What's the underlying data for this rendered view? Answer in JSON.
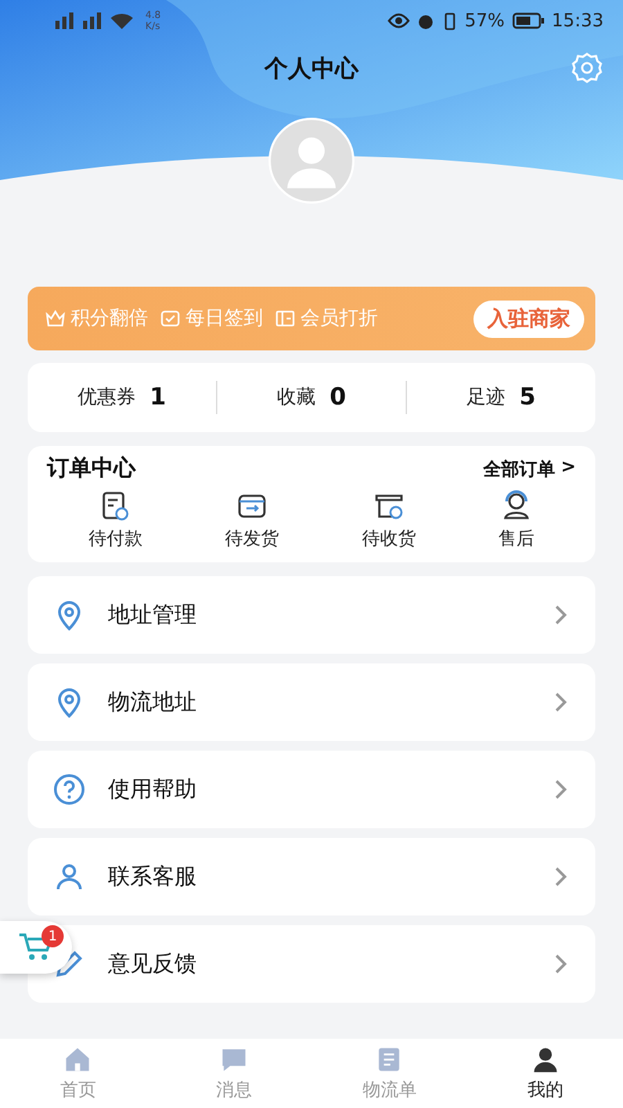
{
  "status_bar": {
    "speed_value": "4.8",
    "speed_unit": "K/s",
    "battery": "57%",
    "time": "15:33"
  },
  "header": {
    "title": "个人中心"
  },
  "promo_banner": {
    "perks": [
      {
        "kind": "crown",
        "label": "积分翻倍"
      },
      {
        "kind": "calendar",
        "label": "每日签到"
      },
      {
        "kind": "ticket",
        "label": "会员打折"
      }
    ],
    "button": "入驻商家"
  },
  "stats": [
    {
      "label": "优惠券",
      "value": "1"
    },
    {
      "label": "收藏",
      "value": "0"
    },
    {
      "label": "足迹",
      "value": "5"
    }
  ],
  "orders": {
    "title": "订单中心",
    "all_link": "全部订单",
    "all_link_arrow": ">",
    "items": [
      {
        "kind": "payment",
        "label": "待付款"
      },
      {
        "kind": "shipment",
        "label": "待发货"
      },
      {
        "kind": "receipt",
        "label": "待收货"
      },
      {
        "kind": "service",
        "label": "售后"
      }
    ]
  },
  "menu": [
    {
      "kind": "location",
      "label": "地址管理"
    },
    {
      "kind": "location",
      "label": "物流地址"
    },
    {
      "kind": "help",
      "label": "使用帮助"
    },
    {
      "kind": "person",
      "label": "联系客服"
    },
    {
      "kind": "edit",
      "label": "意见反馈"
    }
  ],
  "cart_badge": "1",
  "tab_bar": [
    {
      "kind": "home",
      "label": "首页",
      "selected": false
    },
    {
      "kind": "message",
      "label": "消息",
      "selected": false
    },
    {
      "kind": "list",
      "label": "物流单",
      "selected": false
    },
    {
      "kind": "user",
      "label": "我的",
      "selected": true
    }
  ]
}
